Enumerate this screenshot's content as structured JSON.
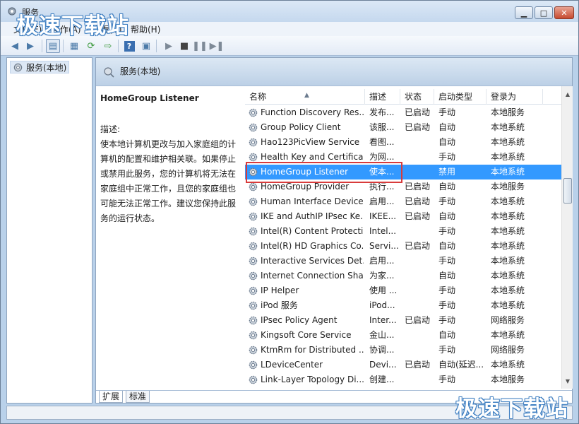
{
  "window": {
    "title": "服务"
  },
  "menu": [
    {
      "label": "文件(F)"
    },
    {
      "label": "操作(A)"
    },
    {
      "label": "查看(V)"
    },
    {
      "label": "帮助(H)"
    }
  ],
  "tree": {
    "root": "服务(本地)"
  },
  "pane": {
    "header": "服务(本地)"
  },
  "detail": {
    "title": "HomeGroup Listener",
    "desc_label": "描述:",
    "desc_text": "使本地计算机更改与加入家庭组的计算机的配置和维护相关联。如果停止或禁用此服务，您的计算机将无法在家庭组中正常工作，且您的家庭组也可能无法正常工作。建议您保持此服务的运行状态。"
  },
  "columns": {
    "name": "名称",
    "desc": "描述",
    "status": "状态",
    "startup": "启动类型",
    "logon": "登录为"
  },
  "services": [
    {
      "name": "Function Discovery Res...",
      "desc": "发布...",
      "status": "已启动",
      "startup": "手动",
      "logon": "本地服务"
    },
    {
      "name": "Group Policy Client",
      "desc": "该服...",
      "status": "已启动",
      "startup": "自动",
      "logon": "本地系统"
    },
    {
      "name": "Hao123PicView Service",
      "desc": "看图...",
      "status": "",
      "startup": "自动",
      "logon": "本地系统"
    },
    {
      "name": "Health Key and Certifica...",
      "desc": "为网...",
      "status": "",
      "startup": "手动",
      "logon": "本地系统"
    },
    {
      "name": "HomeGroup Listener",
      "desc": "使本...",
      "status": "",
      "startup": "禁用",
      "logon": "本地系统"
    },
    {
      "name": "HomeGroup Provider",
      "desc": "执行...",
      "status": "已启动",
      "startup": "自动",
      "logon": "本地服务"
    },
    {
      "name": "Human Interface Device...",
      "desc": "启用...",
      "status": "已启动",
      "startup": "手动",
      "logon": "本地系统"
    },
    {
      "name": "IKE and AuthIP IPsec Ke...",
      "desc": "IKEE...",
      "status": "已启动",
      "startup": "自动",
      "logon": "本地系统"
    },
    {
      "name": "Intel(R) Content Protecti...",
      "desc": "Intel...",
      "status": "",
      "startup": "手动",
      "logon": "本地系统"
    },
    {
      "name": "Intel(R) HD Graphics Co...",
      "desc": "Servi...",
      "status": "已启动",
      "startup": "自动",
      "logon": "本地系统"
    },
    {
      "name": "Interactive Services Det...",
      "desc": "启用...",
      "status": "",
      "startup": "手动",
      "logon": "本地系统"
    },
    {
      "name": "Internet Connection Sha...",
      "desc": "为家...",
      "status": "",
      "startup": "自动",
      "logon": "本地系统"
    },
    {
      "name": "IP Helper",
      "desc": "使用 ...",
      "status": "",
      "startup": "手动",
      "logon": "本地系统"
    },
    {
      "name": "iPod 服务",
      "desc": "iPod...",
      "status": "",
      "startup": "手动",
      "logon": "本地系统"
    },
    {
      "name": "IPsec Policy Agent",
      "desc": "Inter...",
      "status": "已启动",
      "startup": "手动",
      "logon": "网络服务"
    },
    {
      "name": "Kingsoft Core Service",
      "desc": "金山...",
      "status": "",
      "startup": "自动",
      "logon": "本地系统"
    },
    {
      "name": "KtmRm for Distributed ...",
      "desc": "协调...",
      "status": "",
      "startup": "手动",
      "logon": "网络服务"
    },
    {
      "name": "LDeviceCenter",
      "desc": "Devi...",
      "status": "已启动",
      "startup": "自动(延迟...",
      "logon": "本地系统"
    },
    {
      "name": "Link-Layer Topology Di...",
      "desc": "创建...",
      "status": "",
      "startup": "手动",
      "logon": "本地服务"
    }
  ],
  "selected_index": 4,
  "tabs": [
    {
      "label": "扩展"
    },
    {
      "label": "标准"
    }
  ],
  "watermark": "极速下载站",
  "colors": {
    "selection": "#3399ff",
    "highlight_box": "#d83b3b"
  }
}
